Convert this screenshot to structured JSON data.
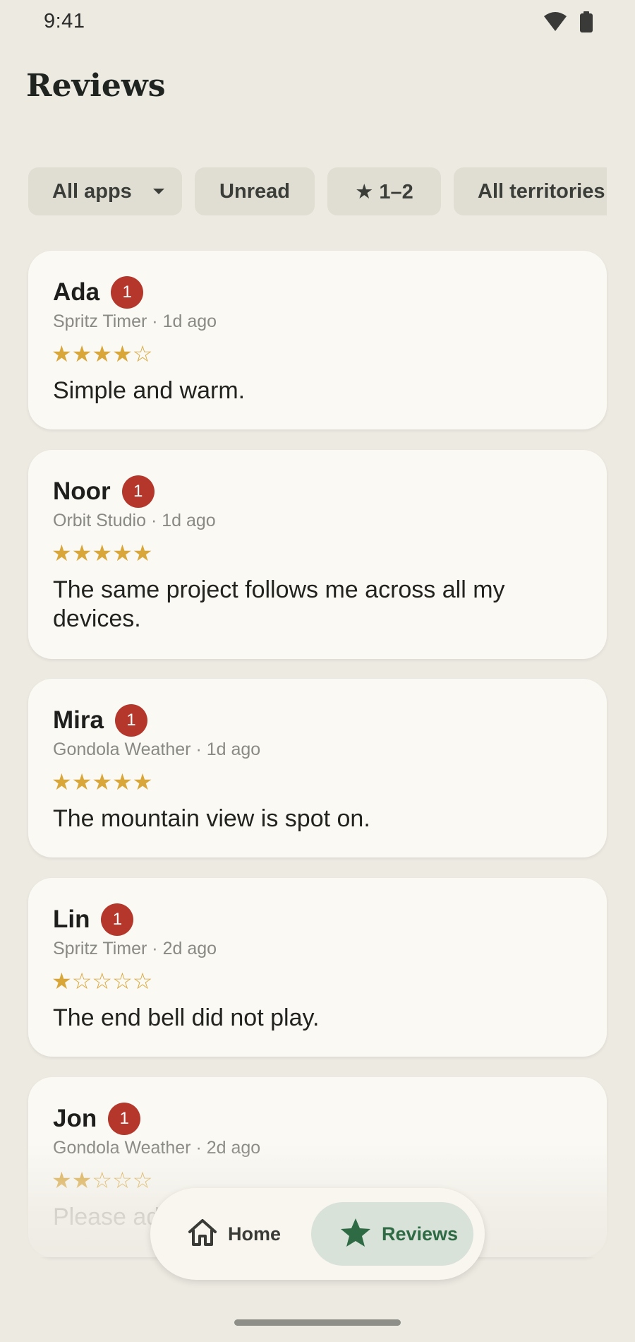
{
  "status_bar": {
    "time": "9:41"
  },
  "header": {
    "title": "Reviews"
  },
  "filters": [
    {
      "label": "All apps"
    },
    {
      "label": "Unread"
    },
    {
      "label": "★ 1–2"
    },
    {
      "label": "All territories"
    }
  ],
  "reviews": [
    {
      "reviewer": "Ada",
      "badge": "1",
      "meta": "Spritz Timer · 1d ago",
      "stars": "★★★★☆",
      "rating": 4,
      "text": "Simple and warm."
    },
    {
      "reviewer": "Noor",
      "badge": "1",
      "meta": "Orbit Studio · 1d ago",
      "stars": "★★★★★",
      "rating": 5,
      "text": "The same project follows me across all my devices."
    },
    {
      "reviewer": "Mira",
      "badge": "1",
      "meta": "Gondola Weather · 1d ago",
      "stars": "★★★★★",
      "rating": 5,
      "text": "The mountain view is spot on."
    },
    {
      "reviewer": "Lin",
      "badge": "1",
      "meta": "Spritz Timer · 2d ago",
      "stars": "★☆☆☆☆",
      "rating": 1,
      "text": "The end bell did not play."
    },
    {
      "reviewer": "Jon",
      "badge": "1",
      "meta": "Gondola Weather · 2d ago",
      "stars": "★★☆☆☆",
      "rating": 2,
      "text": "Please ad"
    }
  ],
  "bottom_nav": {
    "items": [
      {
        "label": "Home",
        "icon": "home-icon"
      },
      {
        "label": "Reviews",
        "icon": "star-icon",
        "selected": true
      }
    ]
  },
  "colors": {
    "background": "#EDEAE2",
    "card": "#FAF9F4",
    "badge": "#B5372B",
    "star": "#D9A63A",
    "nav_selected_bg": "#D8E2D9",
    "nav_selected_fg": "#2E6A43"
  }
}
